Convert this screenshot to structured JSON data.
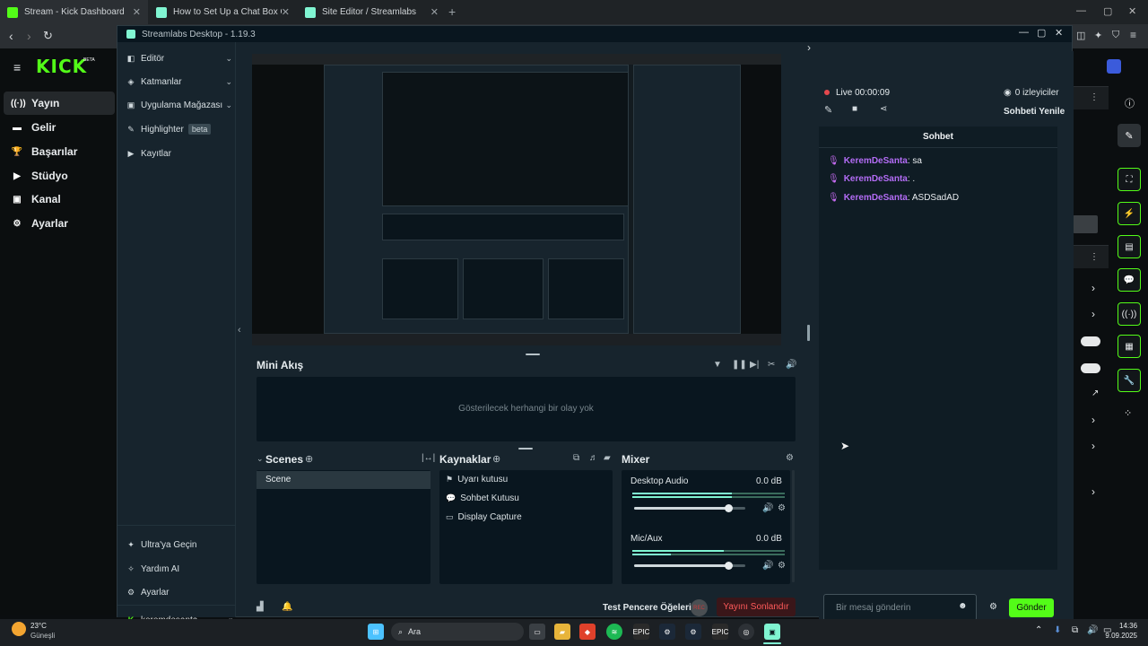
{
  "browser": {
    "tabs": [
      {
        "label": "Stream - Kick Dashboard",
        "color": "#53fc18"
      },
      {
        "label": "How to Set Up a Chat Box Overlay | S",
        "color": "#80f5d2"
      },
      {
        "label": "Site Editor / Streamlabs",
        "color": "#80f5d2"
      }
    ]
  },
  "kick": {
    "logo": "KICK",
    "logo_badge": "BETA",
    "nav": [
      {
        "label": "Yayın",
        "icon": "broadcast-icon"
      },
      {
        "label": "Gelir",
        "icon": "money-icon"
      },
      {
        "label": "Başarılar",
        "icon": "trophy-icon"
      },
      {
        "label": "Stüdyo",
        "icon": "studio-icon"
      },
      {
        "label": "Kanal",
        "icon": "channel-icon"
      },
      {
        "label": "Ayarlar",
        "icon": "gear-icon"
      }
    ]
  },
  "streamlabs": {
    "title": "Streamlabs Desktop - 1.19.3",
    "sidebar": {
      "top": [
        {
          "label": "Editör",
          "icon": "editor-icon"
        },
        {
          "label": "Katmanlar",
          "icon": "layers-icon"
        },
        {
          "label": "Uygulama Mağazası",
          "icon": "store-icon"
        },
        {
          "label": "Highlighter",
          "icon": "highlighter-icon",
          "badge": "beta"
        },
        {
          "label": "Kayıtlar",
          "icon": "record-icon"
        }
      ],
      "bottom": [
        {
          "label": "Ultra'ya Geçin",
          "icon": "ultra-icon"
        },
        {
          "label": "Yardım AI",
          "icon": "help-icon"
        },
        {
          "label": "Ayarlar",
          "icon": "gear-icon"
        }
      ],
      "account": "keremdesanta"
    },
    "mini_feed": {
      "title": "Mini Akış",
      "empty": "Gösterilecek herhangi bir olay yok"
    },
    "scenes": {
      "title": "Scenes",
      "items": [
        "Scene"
      ]
    },
    "sources": {
      "title": "Kaynaklar",
      "items": [
        {
          "label": "Uyarı kutusu",
          "icon": "alert-box-icon"
        },
        {
          "label": "Sohbet Kutusu",
          "icon": "chat-box-icon"
        },
        {
          "label": "Display Capture",
          "icon": "monitor-icon"
        }
      ]
    },
    "mixer": {
      "title": "Mixer",
      "channels": [
        {
          "name": "Desktop Audio",
          "db": "0.0 dB",
          "level": 0.85
        },
        {
          "name": "Mic/Aux",
          "db": "0.0 dB",
          "level": 0.85
        }
      ]
    },
    "footer": {
      "test_label": "Test Pencere Öğeleri",
      "rec": "REC",
      "end_stream": "Yayını Sonlandır"
    }
  },
  "chat_panel": {
    "live": "Live 00:00:09",
    "viewers": "0 izleyiciler",
    "refresh": "Sohbeti Yenile",
    "title": "Sohbet",
    "messages": [
      {
        "user": "KeremDeSanta",
        "text": ": sa"
      },
      {
        "user": "KeremDeSanta",
        "text": ": ."
      },
      {
        "user": "KeremDeSanta",
        "text": ": ASDSadAD"
      }
    ],
    "input_placeholder": "Bir mesaj gönderin",
    "send": "Gönder"
  },
  "taskbar": {
    "weather_temp": "23°C",
    "weather_desc": "Güneşli",
    "search": "Ara",
    "time": "14:36",
    "date": "9.09.2025"
  }
}
